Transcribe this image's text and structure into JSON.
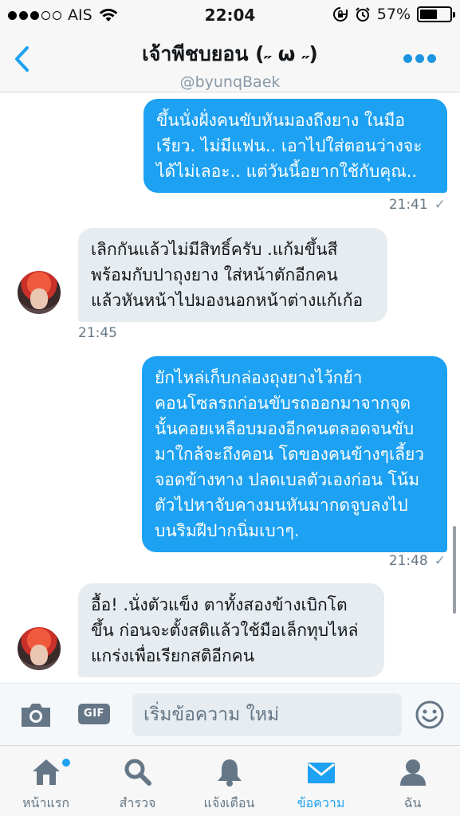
{
  "status_bar": {
    "carrier": "AIS",
    "time": "22:04",
    "battery_percent": "57%",
    "battery_level": 0.57,
    "signal_bars_filled": 3,
    "signal_bars_total": 5
  },
  "header": {
    "title": "เจ้าพีชบยอน (˶ ω ˶)",
    "handle": "@byunqBaek",
    "accent": "#1da1f2"
  },
  "messages": [
    {
      "side": "sent",
      "lines": [
        "ขึ้นนั่งฝั่งคนขับหันมองถึงยาง ในมือ",
        "เรียว. ไม่มีแฟน.. เอาไปใส่ตอนว่างจะ",
        "ได้ไม่เลอะ.. แต่วันนี้อยากใช้กับคุณ.."
      ],
      "time": "21:41",
      "receipt": "✓"
    },
    {
      "side": "received",
      "lines": [
        "เลิกกันแล้วไม่มีสิทธิ์ครับ .แก้มขึ้นสี",
        "พร้อมกับปาถุงยาง ใส่หน้าตักอีกคน",
        "แล้วหันหน้าไปมองนอกหน้าต่างแก้เก้อ"
      ],
      "time": "21:45"
    },
    {
      "side": "sent",
      "lines": [
        "ยักไหล่เก็บกล่องถุงยางไว้กย้า",
        "คอนโซลรถก่อนขับรถออกมาจากจุด",
        "นั้นคอยเหลือบมองอีกคนตลอดจนขับ",
        "มาใกล้จะถึงคอน โดของคนข้างๆเลี้ยว",
        "จอดข้างทาง ปลดเบลตัวเองก่อน โน้ม",
        "ตัวไปหาจับคางมนหันมากดจูบลงไป",
        "บนริมฝีปากนิ่มเบาๆ."
      ],
      "time": "21:48",
      "receipt": "✓"
    },
    {
      "side": "received",
      "lines": [
        "อื้อ! .นั่งตัวแข็ง ตาทั้งสองข้างเบิกโต",
        "ขึ้น ก่อนจะตั้งสติแล้วใช้มือเล็กทุบไหล่",
        "แกร่งเพื่อเรียกสติอีกคน"
      ]
    }
  ],
  "composer": {
    "placeholder": "เริ่มข้อความ ใหม่",
    "gif_label": "GIF",
    "camera_icon": "camera-icon",
    "emoji_icon": "smiley-icon"
  },
  "tabs": [
    {
      "label": "หน้าแรก",
      "icon": "home-icon",
      "active": false,
      "badge": true
    },
    {
      "label": "สำรวจ",
      "icon": "search-icon",
      "active": false
    },
    {
      "label": "แจ้งเตือน",
      "icon": "bell-icon",
      "active": false
    },
    {
      "label": "ข้อความ",
      "icon": "envelope-icon",
      "active": true
    },
    {
      "label": "ฉัน",
      "icon": "profile-icon",
      "active": false
    }
  ]
}
